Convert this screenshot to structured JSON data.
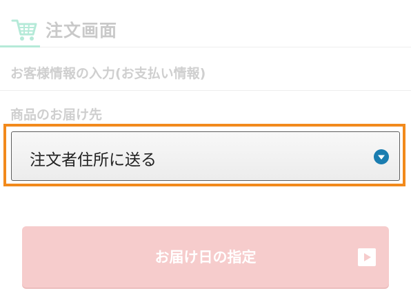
{
  "header": {
    "title": "注文画面",
    "icon": "shopping-cart-icon",
    "accent_color": "#b5ead8"
  },
  "customer_info": {
    "heading": "お客様情報の入力(お支払い情報)"
  },
  "delivery": {
    "heading": "お届け先",
    "heading_prefix": "商品の",
    "select": {
      "selected_value": "注文者住所に送る",
      "arrow_icon": "chevron-down-circle-icon",
      "arrow_color": "#1a7db0"
    },
    "highlight_color": "#f28a1c"
  },
  "delivery_date_button": {
    "label": "お届け日の指定",
    "icon": "play-icon",
    "color": "#f6cccc"
  }
}
